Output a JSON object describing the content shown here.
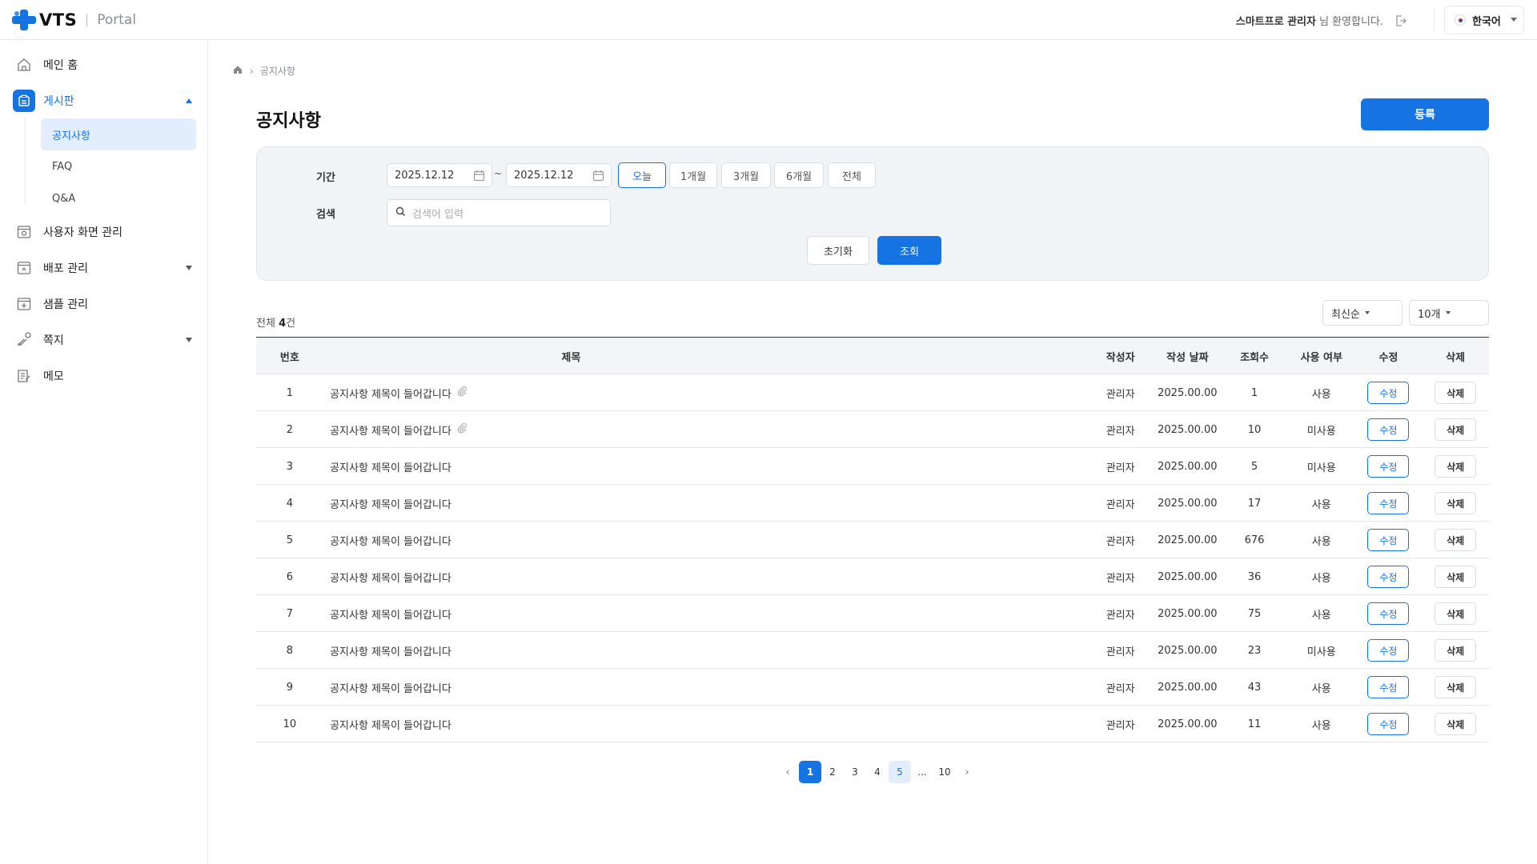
{
  "header": {
    "logo_text": "VTS",
    "logo_sub": "Portal",
    "welcome_name": "스마트프로 관리자",
    "welcome_suffix": "님 환영합니다.",
    "language": "한국어"
  },
  "sidebar": {
    "items": [
      {
        "label": "메인 홈",
        "icon": "home-icon"
      },
      {
        "label": "게시판",
        "icon": "board-icon"
      },
      {
        "label": "사용자 화면 관리",
        "icon": "screen-settings-icon"
      },
      {
        "label": "배포 관리",
        "icon": "deploy-icon"
      },
      {
        "label": "샘플 관리",
        "icon": "sample-icon"
      },
      {
        "label": "쪽지",
        "icon": "message-icon"
      },
      {
        "label": "메모",
        "icon": "memo-icon"
      }
    ],
    "sub_items": [
      {
        "label": "공지사항"
      },
      {
        "label": "FAQ"
      },
      {
        "label": "Q&A"
      }
    ]
  },
  "breadcrumb": {
    "current": "공지사항"
  },
  "page": {
    "title": "공지사항",
    "register_label": "등록"
  },
  "filter": {
    "period_label": "기간",
    "start_date": "2025.12.12",
    "end_date": "2025.12.12",
    "tilde": "~",
    "periods": [
      "오늘",
      "1개월",
      "3개월",
      "6개월",
      "전체"
    ],
    "search_label": "검색",
    "search_placeholder": "검색어 입력",
    "reset_label": "초기화",
    "search_button": "조회"
  },
  "list": {
    "total_prefix": "전체",
    "total_count": "4",
    "total_suffix": "건",
    "sort_value": "최신순",
    "page_size_value": "10개"
  },
  "table": {
    "headers": [
      "번호",
      "제목",
      "작성자",
      "작성 날짜",
      "조회수",
      "사용 여부",
      "수정",
      "삭제"
    ],
    "edit_label": "수정",
    "delete_label": "삭제",
    "rows": [
      {
        "no": "1",
        "title": "공지사항 제목이 들어갑니다",
        "attach": true,
        "author": "관리자",
        "date": "2025.00.00",
        "views": "1",
        "use": "사용"
      },
      {
        "no": "2",
        "title": "공지사항 제목이 들어갑니다",
        "attach": true,
        "author": "관리자",
        "date": "2025.00.00",
        "views": "10",
        "use": "미사용"
      },
      {
        "no": "3",
        "title": "공지사항 제목이 들어갑니다",
        "attach": false,
        "author": "관리자",
        "date": "2025.00.00",
        "views": "5",
        "use": "미사용"
      },
      {
        "no": "4",
        "title": "공지사항 제목이 들어갑니다",
        "attach": false,
        "author": "관리자",
        "date": "2025.00.00",
        "views": "17",
        "use": "사용"
      },
      {
        "no": "5",
        "title": "공지사항 제목이 들어갑니다",
        "attach": false,
        "author": "관리자",
        "date": "2025.00.00",
        "views": "676",
        "use": "사용"
      },
      {
        "no": "6",
        "title": "공지사항 제목이 들어갑니다",
        "attach": false,
        "author": "관리자",
        "date": "2025.00.00",
        "views": "36",
        "use": "사용"
      },
      {
        "no": "7",
        "title": "공지사항 제목이 들어갑니다",
        "attach": false,
        "author": "관리자",
        "date": "2025.00.00",
        "views": "75",
        "use": "사용"
      },
      {
        "no": "8",
        "title": "공지사항 제목이 들어갑니다",
        "attach": false,
        "author": "관리자",
        "date": "2025.00.00",
        "views": "23",
        "use": "미사용"
      },
      {
        "no": "9",
        "title": "공지사항 제목이 들어갑니다",
        "attach": false,
        "author": "관리자",
        "date": "2025.00.00",
        "views": "43",
        "use": "사용"
      },
      {
        "no": "10",
        "title": "공지사항 제목이 들어갑니다",
        "attach": false,
        "author": "관리자",
        "date": "2025.00.00",
        "views": "11",
        "use": "사용"
      }
    ]
  },
  "pagination": {
    "prev": "‹",
    "next": "›",
    "pages": [
      "1",
      "2",
      "3",
      "4",
      "5",
      "...",
      "10"
    ],
    "current": "1",
    "hovered": "5"
  },
  "colors": {
    "accent": "#1673e2",
    "accent_light": "#e3eefc",
    "filter_bg": "#f1f4f7"
  }
}
